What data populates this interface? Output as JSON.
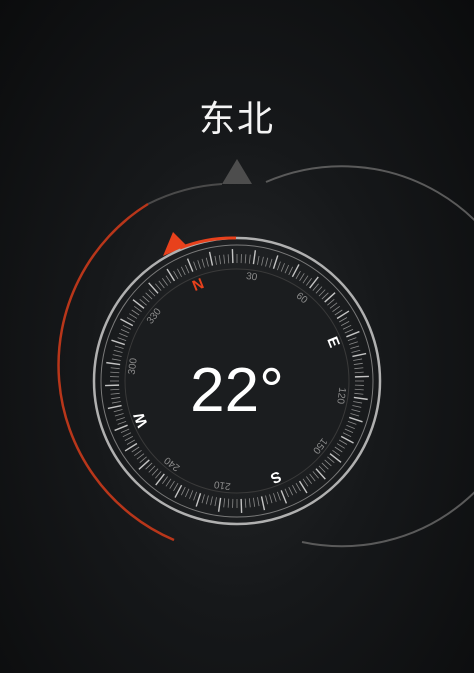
{
  "header": {
    "direction_label": "东北"
  },
  "compass": {
    "heading_text": "22°",
    "heading_degrees": 22,
    "cardinals": {
      "north": "N",
      "east": "E",
      "south": "S",
      "west": "W"
    },
    "degree_labels": [
      "30",
      "60",
      "120",
      "150",
      "210",
      "240",
      "300",
      "330"
    ],
    "colors": {
      "accent": "#e8411c",
      "ring": "#9a9a9a",
      "tick": "#8a8a8a",
      "text": "#ffffff"
    }
  }
}
